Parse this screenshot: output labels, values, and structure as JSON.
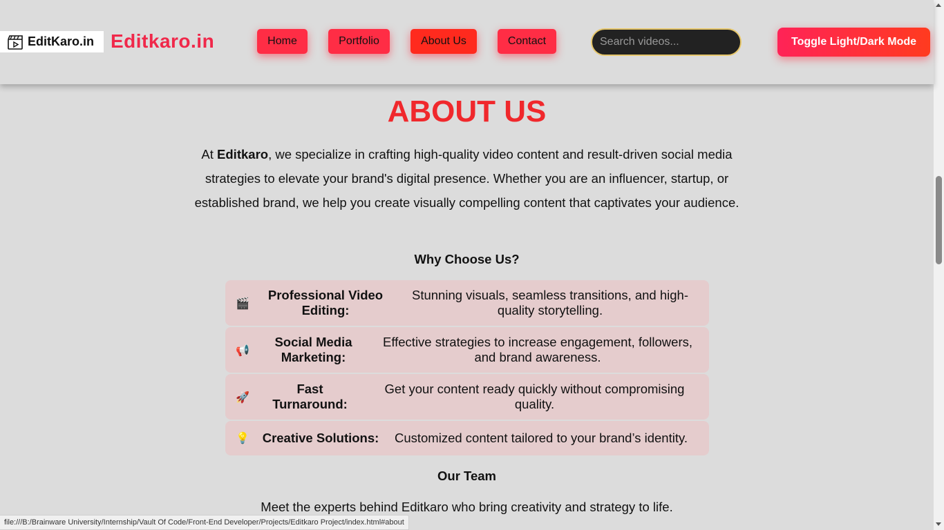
{
  "header": {
    "logo_text": "EditKaro.in",
    "brand": "Editkaro.in",
    "nav": [
      {
        "label": "Home",
        "active": false
      },
      {
        "label": "Portfolio",
        "active": false
      },
      {
        "label": "About Us",
        "active": true
      },
      {
        "label": "Contact",
        "active": false
      }
    ],
    "search_placeholder": "Search videos...",
    "toggle_label": "Toggle Light/Dark Mode"
  },
  "about": {
    "title": "ABOUT US",
    "intro_prefix": "At ",
    "intro_brand": "Editkaro",
    "intro_rest": ", we specialize in crafting high-quality video content and result-driven social media strategies to elevate your brand's digital presence. Whether you are an influencer, startup, or established brand, we help you create visually compelling content that captivates your audience.",
    "why_heading": "Why Choose Us?",
    "features": [
      {
        "icon": "clapper-board-icon",
        "emoji": "🎬",
        "title": "Professional Video Editing:",
        "desc": "Stunning visuals, seamless transitions, and high-quality storytelling."
      },
      {
        "icon": "megaphone-icon",
        "emoji": "📢",
        "title": "Social Media Marketing:",
        "desc": "Effective strategies to increase engagement, followers, and brand awareness."
      },
      {
        "icon": "rocket-icon",
        "emoji": "🚀",
        "title": "Fast Turnaround:",
        "desc": "Get your content ready quickly without compromising quality."
      },
      {
        "icon": "lightbulb-icon",
        "emoji": "💡",
        "title": "Creative Solutions:",
        "desc": "Customized content tailored to your brand’s identity."
      }
    ],
    "team_heading": "Our Team",
    "team_text": "Meet the experts behind Editkaro who bring creativity and strategy to life."
  },
  "statusbar": {
    "url": "file:///B:/Brainware University/Internship/Vault Of Code/Front-End Developer/Projects/Editkaro Project/index.html#about"
  },
  "colors": {
    "accent": "#f0284a",
    "title_red": "#f0282c",
    "nav_button": "#ff2d45",
    "card_bg": "#e5cccd",
    "page_bg": "#dcdcdc"
  }
}
